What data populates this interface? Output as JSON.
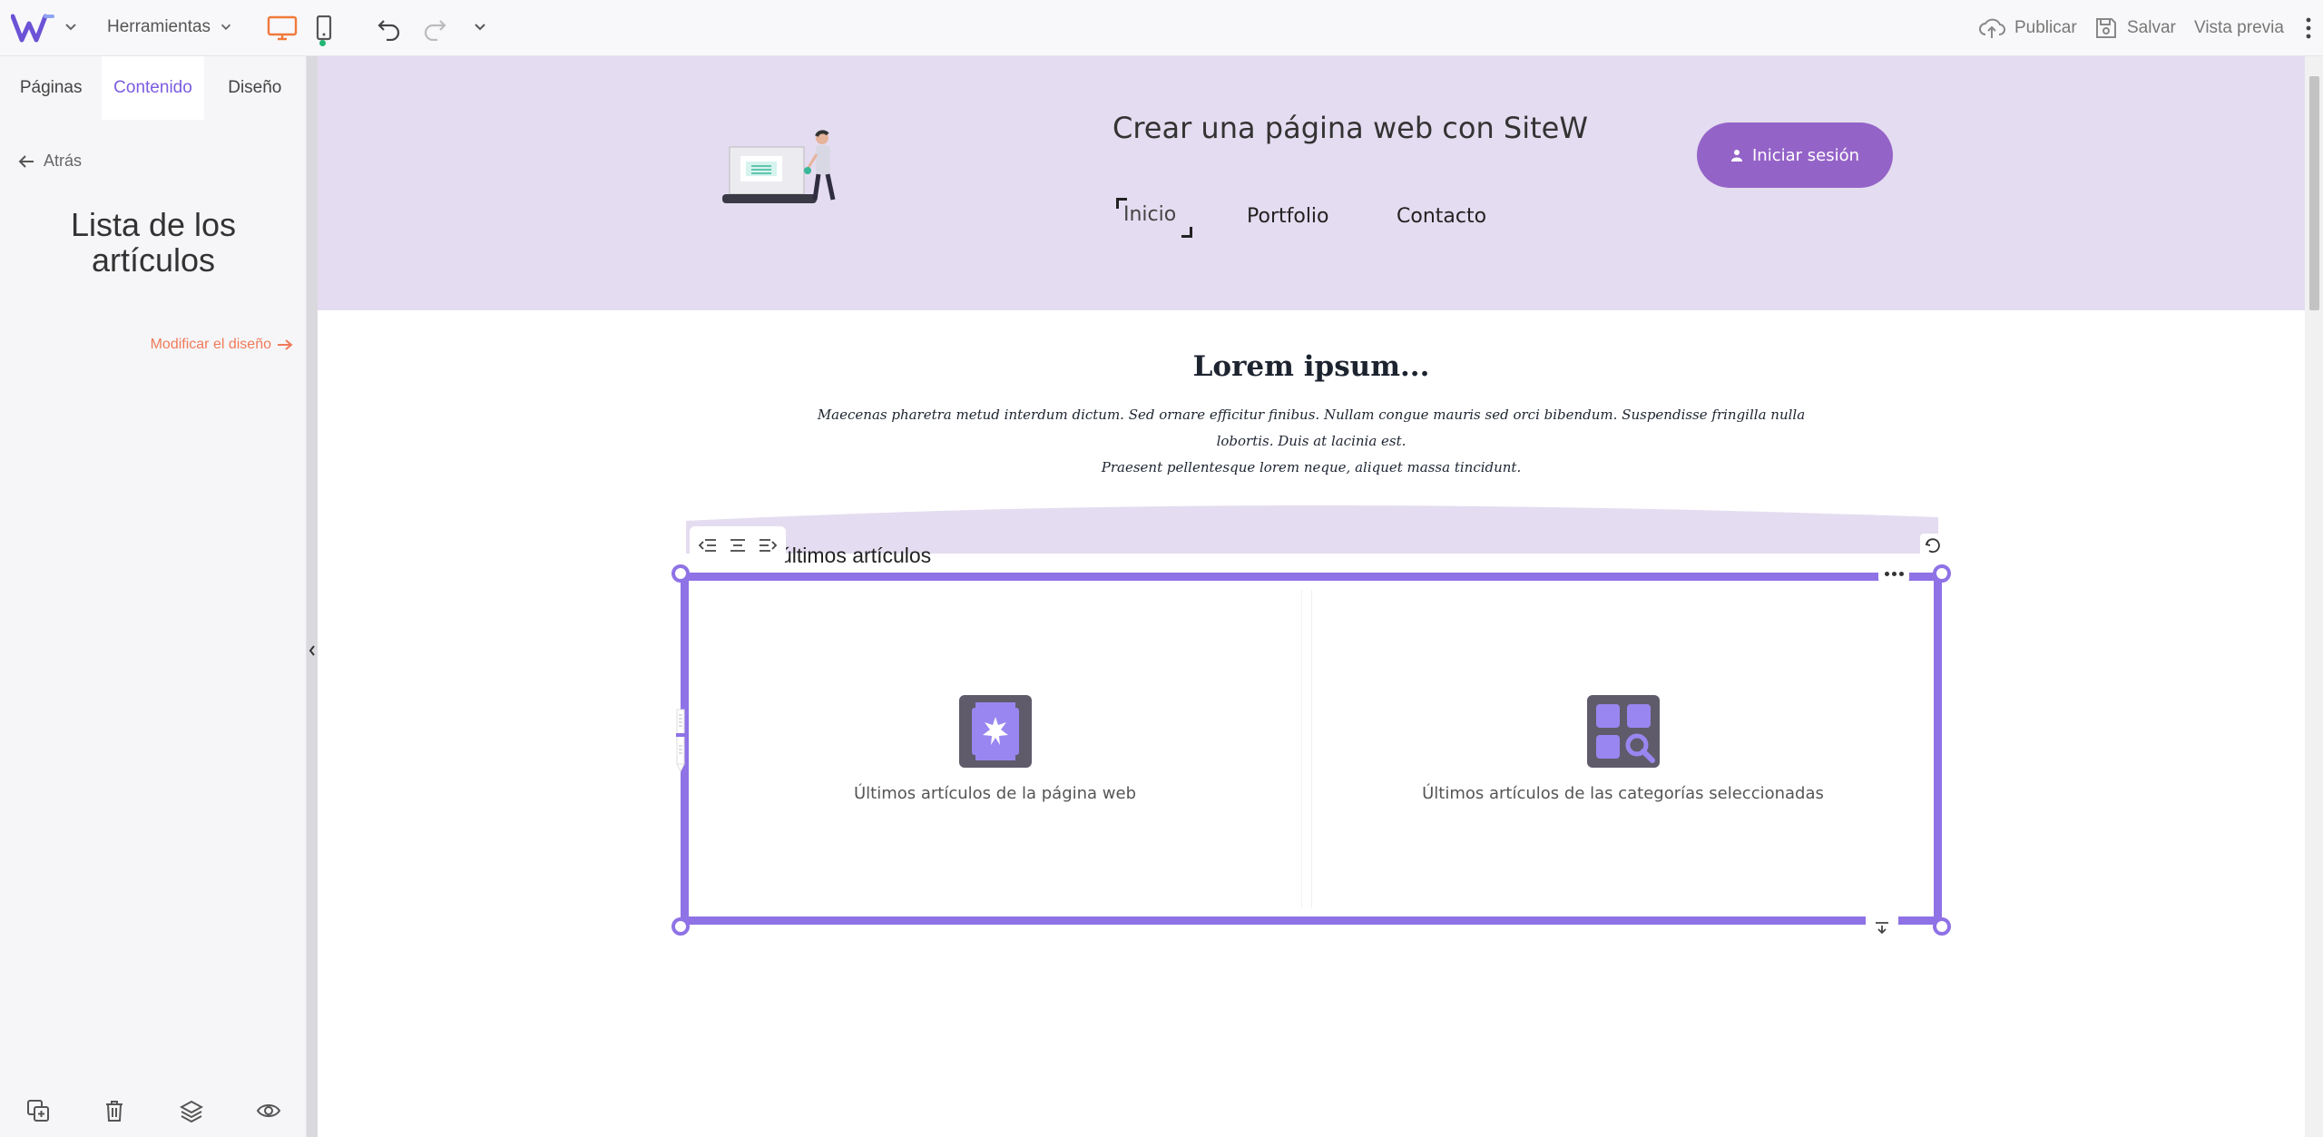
{
  "toolbar": {
    "tools_label": "Herramientas",
    "publish_label": "Publicar",
    "save_label": "Salvar",
    "preview_label": "Vista previa",
    "accent_color": "#f07a3a",
    "brand_color": "#6b52d6"
  },
  "sidebar": {
    "tabs": [
      {
        "label": "Páginas"
      },
      {
        "label": "Contenido"
      },
      {
        "label": "Diseño"
      }
    ],
    "active_tab": "Contenido",
    "back_label": "Atrás",
    "title": "Lista de los artículos",
    "modify_link": "Modificar el diseño"
  },
  "site": {
    "title": "Crear una página web con SiteW",
    "nav": [
      "Inicio",
      "Portfolio",
      "Contacto"
    ],
    "login_label": "Iniciar sesión",
    "header_bg": "#e4dcf0",
    "button_color": "#9463c8"
  },
  "content": {
    "heading": "Lorem ipsum...",
    "paragraph_line1": "Maecenas pharetra metud interdum dictum. Sed ornare efficitur finibus. Nullam congue mauris sed orci bibendum. Suspendisse fringilla nulla lobortis. Duis at lacinia est.",
    "paragraph_line2": "Praesent pellentesque lorem neque, aliquet massa tincidunt."
  },
  "widget": {
    "title": "últimos artículos",
    "option_left": "Últimos artículos de la página web",
    "option_right": "Últimos artículos de las categorías seleccionadas",
    "selection_color": "#8e72e6"
  }
}
